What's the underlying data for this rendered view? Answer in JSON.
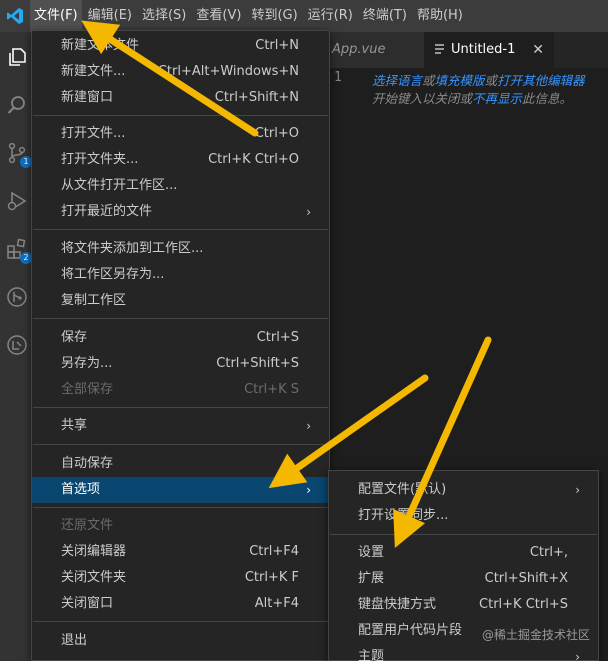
{
  "menubar": {
    "items": [
      "文件(F)",
      "编辑(E)",
      "选择(S)",
      "查看(V)",
      "转到(G)",
      "运行(R)",
      "终端(T)",
      "帮助(H)"
    ],
    "active_index": 0
  },
  "activitybar": {
    "icons": [
      "explorer-icon",
      "search-icon",
      "source-control-icon",
      "run-debug-icon",
      "extensions-icon",
      "git-graph-icon",
      "remote-icon"
    ],
    "badges": {
      "source_control": "1",
      "extensions": "2"
    }
  },
  "tabs": [
    {
      "label": "App.vue"
    },
    {
      "label": "Untitled-1",
      "close": "✕"
    }
  ],
  "editor": {
    "line_number": "1",
    "hint_line1": [
      {
        "text": "选择语言",
        "link": true
      },
      {
        "text": "或",
        "link": false
      },
      {
        "text": "填充模版",
        "link": true
      },
      {
        "text": "或",
        "link": false
      },
      {
        "text": "打开其他编辑器",
        "link": true
      }
    ],
    "hint_line2": [
      {
        "text": "开始键入以关闭或",
        "link": false
      },
      {
        "text": "不再显示",
        "link": true
      },
      {
        "text": "此信息。",
        "link": false
      }
    ]
  },
  "file_menu": {
    "items": [
      {
        "label": "新建文本文件",
        "shortcut": "Ctrl+N"
      },
      {
        "label": "新建文件...",
        "shortcut": "Ctrl+Alt+Windows+N"
      },
      {
        "label": "新建窗口",
        "shortcut": "Ctrl+Shift+N"
      },
      {
        "label": "打开文件...",
        "shortcut": "Ctrl+O"
      },
      {
        "label": "打开文件夹...",
        "shortcut": "Ctrl+K Ctrl+O"
      },
      {
        "label": "从文件打开工作区...",
        "shortcut": ""
      },
      {
        "label": "打开最近的文件",
        "shortcut": "",
        "submenu": true
      },
      {
        "label": "将文件夹添加到工作区...",
        "shortcut": ""
      },
      {
        "label": "将工作区另存为...",
        "shortcut": ""
      },
      {
        "label": "复制工作区",
        "shortcut": ""
      },
      {
        "label": "保存",
        "shortcut": "Ctrl+S"
      },
      {
        "label": "另存为...",
        "shortcut": "Ctrl+Shift+S"
      },
      {
        "label": "全部保存",
        "shortcut": "Ctrl+K S",
        "disabled": true
      },
      {
        "label": "共享",
        "shortcut": "",
        "submenu": true
      },
      {
        "label": "自动保存",
        "shortcut": ""
      },
      {
        "label": "首选项",
        "shortcut": "",
        "submenu": true,
        "selected": true
      },
      {
        "label": "还原文件",
        "shortcut": "",
        "disabled": true
      },
      {
        "label": "关闭编辑器",
        "shortcut": "Ctrl+F4"
      },
      {
        "label": "关闭文件夹",
        "shortcut": "Ctrl+K F"
      },
      {
        "label": "关闭窗口",
        "shortcut": "Alt+F4"
      },
      {
        "label": "退出",
        "shortcut": ""
      }
    ]
  },
  "preferences_menu": {
    "items": [
      {
        "label": "配置文件(默认)",
        "shortcut": "",
        "submenu": true
      },
      {
        "label": "打开设置同步...",
        "shortcut": ""
      },
      {
        "label": "设置",
        "shortcut": "Ctrl+,"
      },
      {
        "label": "扩展",
        "shortcut": "Ctrl+Shift+X"
      },
      {
        "label": "键盘快捷方式",
        "shortcut": "Ctrl+K Ctrl+S"
      },
      {
        "label": "配置用户代码片段",
        "shortcut": ""
      },
      {
        "label": "主题",
        "shortcut": "",
        "submenu": true
      }
    ]
  },
  "watermark": "@稀土掘金技术社区",
  "submenu_arrow": "›",
  "colors": {
    "accent": "#0e70c0",
    "selection": "#094771",
    "link": "#3794ff",
    "annotation_arrow": "#f5b800",
    "logo": "#23a9f2"
  }
}
